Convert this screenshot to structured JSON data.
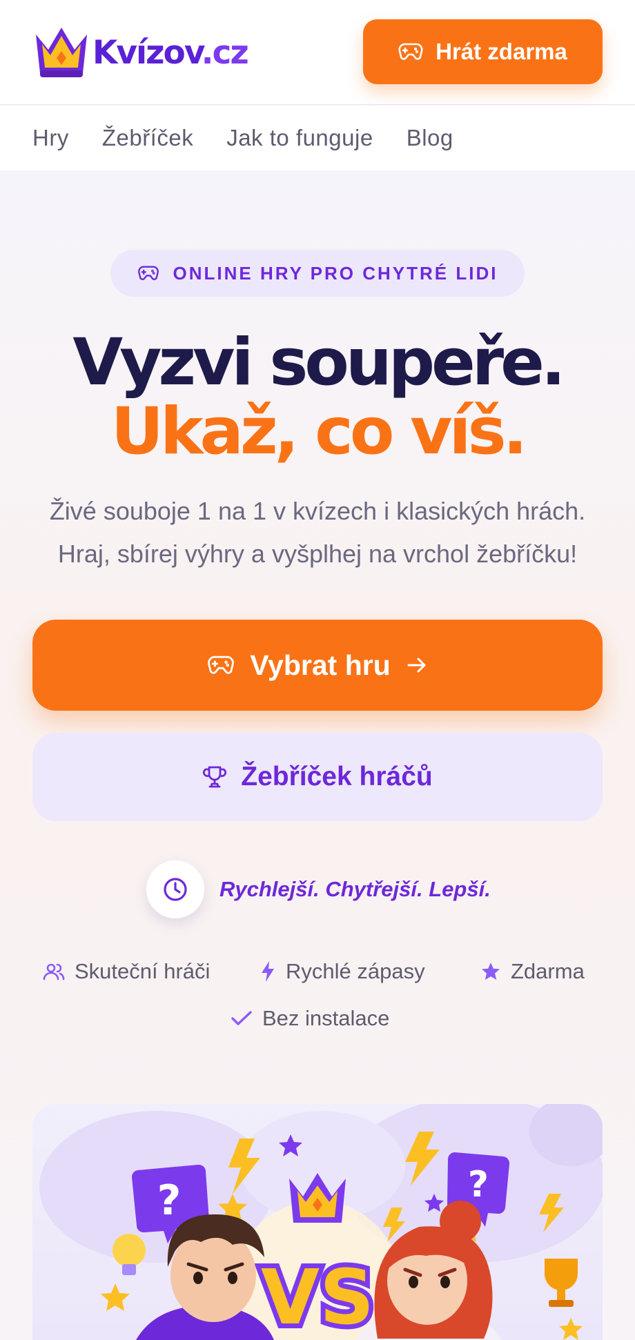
{
  "header": {
    "logo_text": "Kvízov",
    "logo_tld": ".cz",
    "cta_label": "Hrát zdarma",
    "cta_icon": "gamepad-icon"
  },
  "nav": {
    "items": [
      "Hry",
      "Žebříček",
      "Jak to funguje",
      "Blog"
    ]
  },
  "hero": {
    "badge": "ONLINE HRY PRO CHYTRÉ LIDI",
    "badge_icon": "gamepad-icon",
    "title_line1": "Vyzvi soupeře.",
    "title_line2": "Ukaž, co víš.",
    "subtitle_line1": "Živé souboje 1 na 1 v kvízech i klasických hrách.",
    "subtitle_line2": "Hraj, sbírej výhry a vyšplhej na vrchol žebříčku!",
    "primary_button": "Vybrat hru",
    "primary_icon": "gamepad-icon",
    "primary_trailing_icon": "arrow-right-icon",
    "secondary_button": "Žebříček hráčů",
    "secondary_icon": "trophy-icon",
    "tagline": "Rychlejší. Chytřejší. Lepší.",
    "tagline_icon": "clock-icon"
  },
  "features": [
    {
      "label": "Skuteční hráči",
      "icon": "users-icon"
    },
    {
      "label": "Rychlé zápasy",
      "icon": "lightning-icon"
    },
    {
      "label": "Zdarma",
      "icon": "star-icon"
    },
    {
      "label": "Bez instalace",
      "icon": "check-icon"
    }
  ],
  "illustration": {
    "vs_text": "VS",
    "question_mark": "?"
  },
  "colors": {
    "brand_purple": "#6d28d9",
    "accent_orange": "#f97316",
    "heading_navy": "#1e1b4b",
    "muted_text": "#5d5b6e"
  }
}
